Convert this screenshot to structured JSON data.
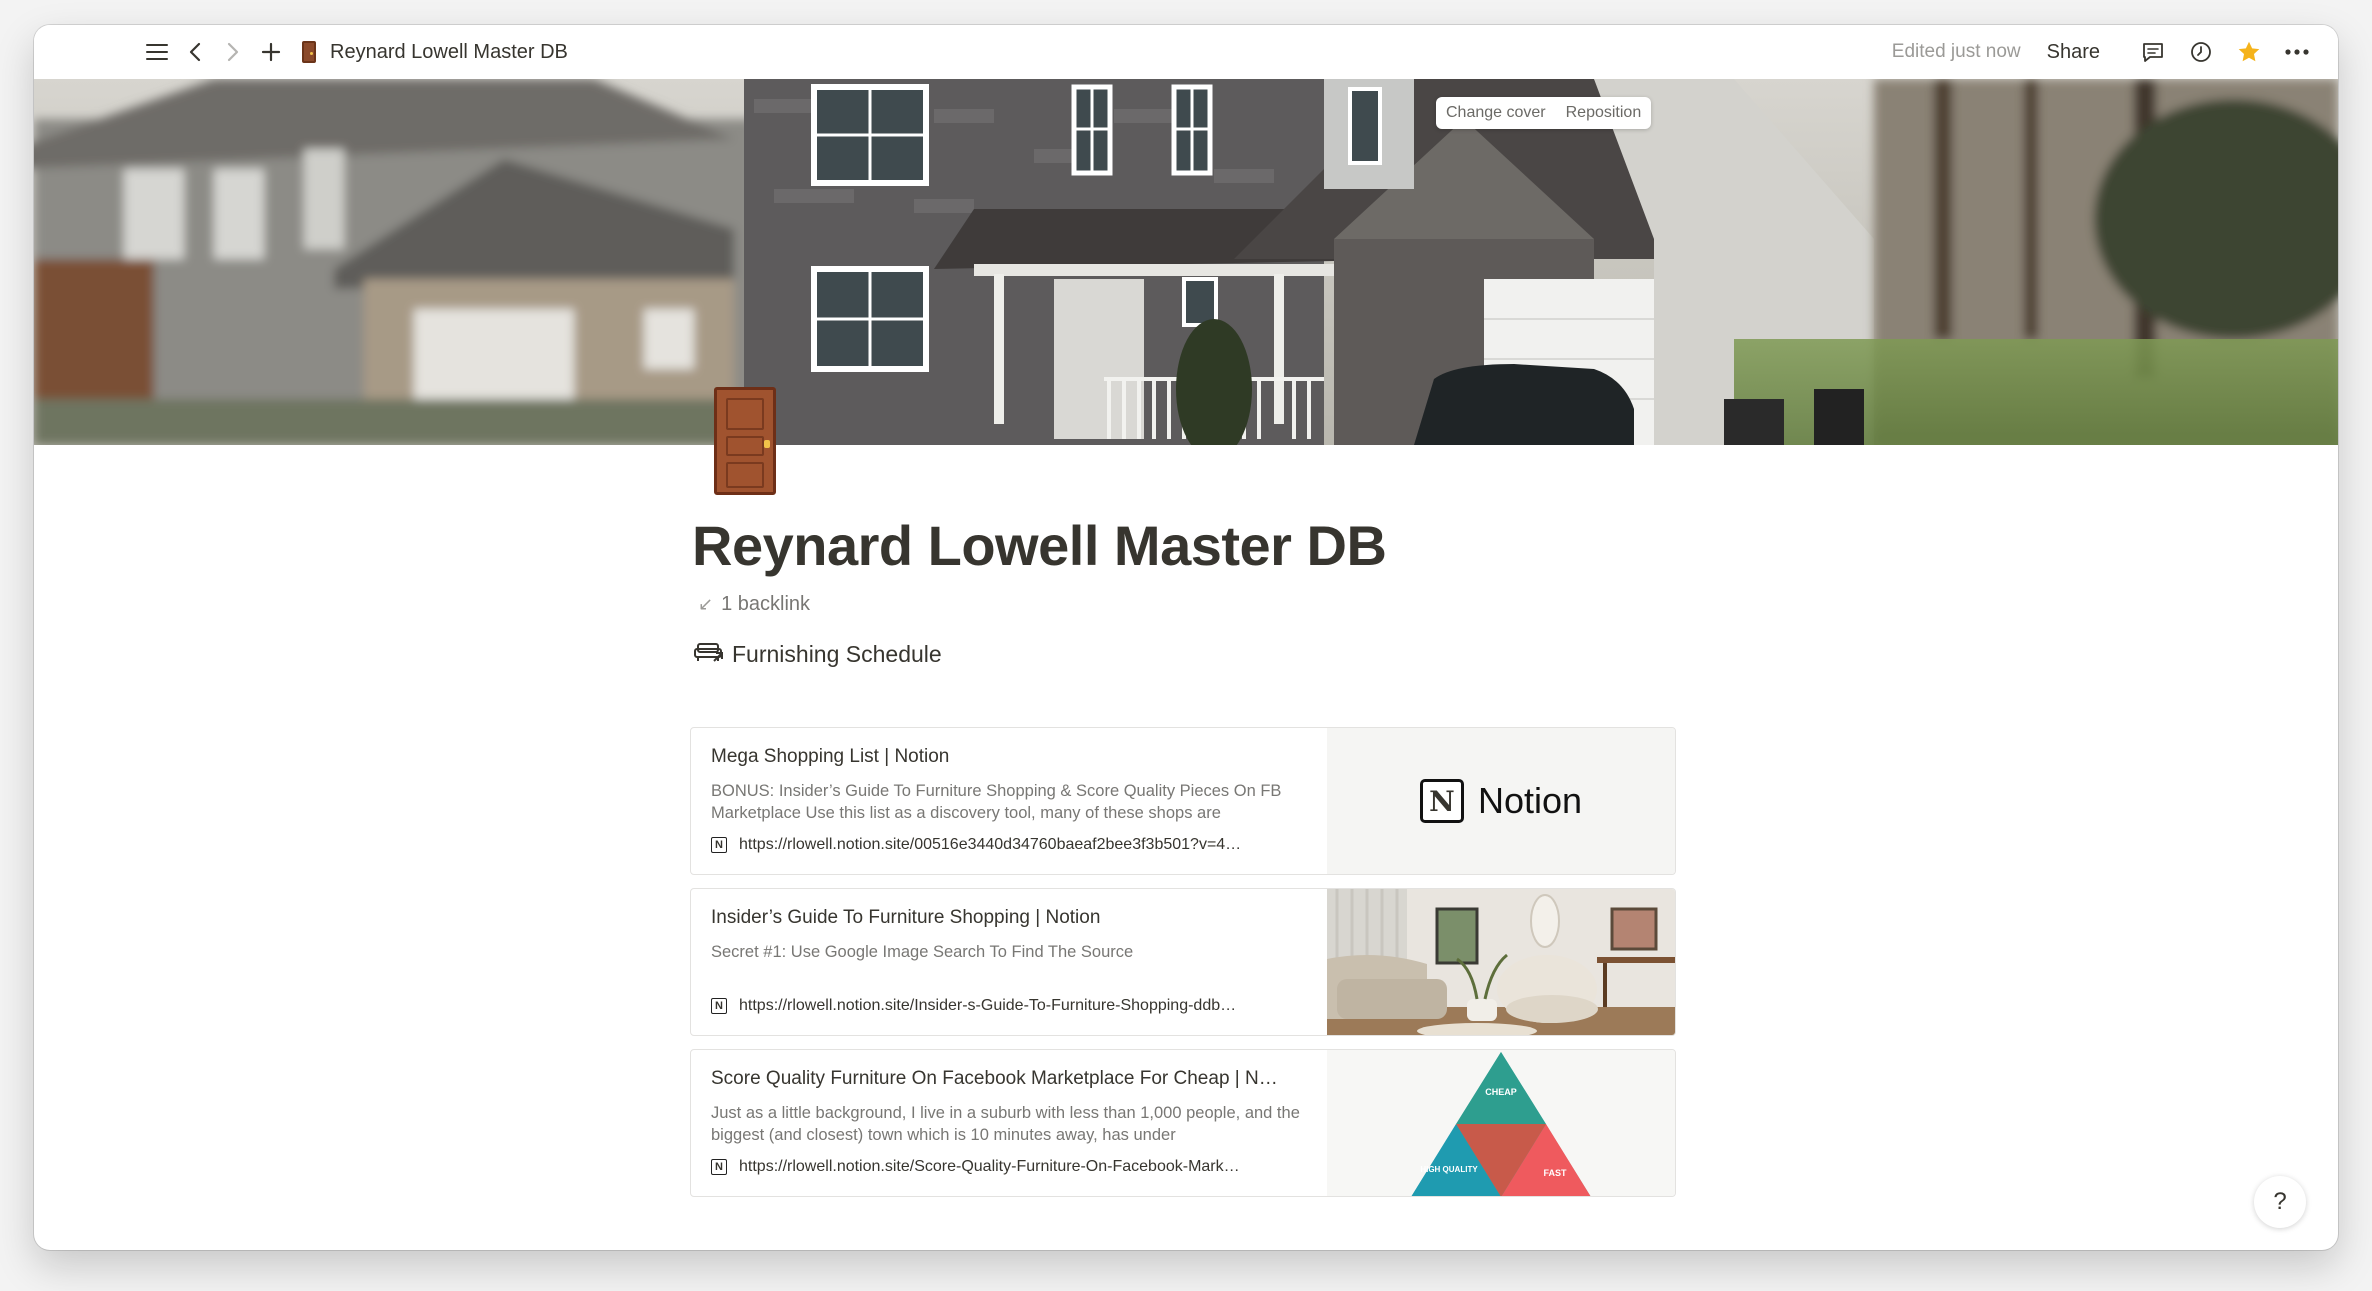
{
  "topbar": {
    "breadcrumb_title": "Reynard Lowell Master DB",
    "edited": "Edited just now",
    "share": "Share",
    "favorite_color": "#f5b31b"
  },
  "cover": {
    "change_cover": "Change cover",
    "reposition": "Reposition"
  },
  "page": {
    "title": "Reynard Lowell Master DB",
    "backlinks": "1 backlink",
    "subpage": "Furnishing Schedule"
  },
  "bookmarks": [
    {
      "title": "Mega Shopping List | Notion",
      "description": "BONUS: Insider’s Guide To Furniture Shopping & Score Quality Pieces On FB Marketplace  Use this list as a discovery tool, many of these shops are",
      "url": "https://rlowell.notion.site/00516e3440d34760baeaf2bee3f3b501?v=4…",
      "thumb_word": "Notion"
    },
    {
      "title": "Insider’s Guide To Furniture Shopping | Notion",
      "description": "Secret #1: Use Google Image Search To Find The Source",
      "url": "https://rlowell.notion.site/Insider-s-Guide-To-Furniture-Shopping-ddb…"
    },
    {
      "title": "Score Quality Furniture On Facebook Marketplace For Cheap | N…",
      "description": "Just as a little background, I live in a suburb with less than 1,000 people, and the biggest (and closest) town which is 10 minutes away, has under",
      "url": "https://rlowell.notion.site/Score-Quality-Furniture-On-Facebook-Mark…",
      "triangle": {
        "top": "CHEAP",
        "left": "HIGH QUALITY",
        "right": "FAST"
      }
    }
  ],
  "help": "?"
}
